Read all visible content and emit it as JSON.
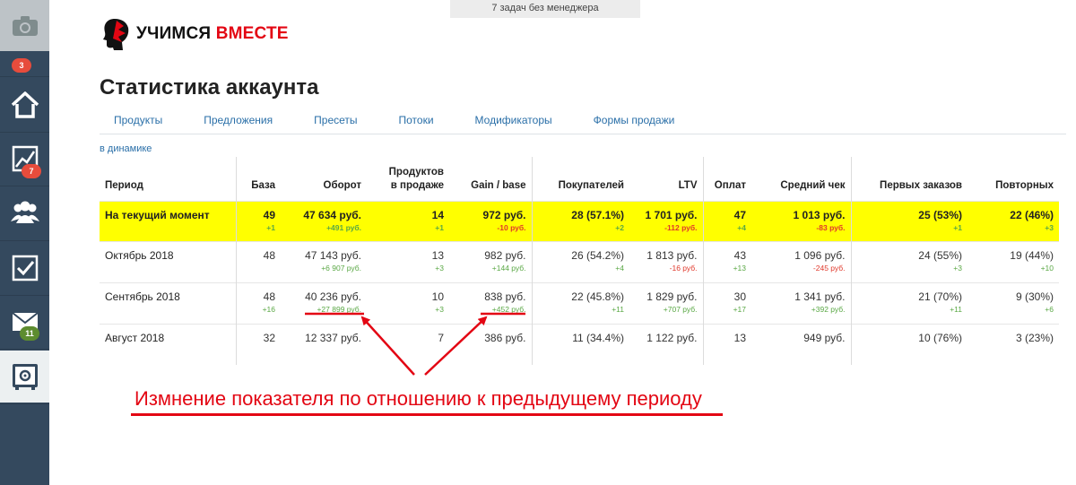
{
  "topbar": {
    "text": "7 задач без менеджера"
  },
  "sidebar": {
    "badges": {
      "notifications": "3",
      "stats": "7",
      "mail": "11"
    }
  },
  "logo": {
    "part1": "УЧИМСЯ",
    "part2": "ВМЕСТЕ"
  },
  "page": {
    "title": "Статистика аккаунта"
  },
  "tabs": [
    "Продукты",
    "Предложения",
    "Пресеты",
    "Потоки",
    "Модификаторы",
    "Формы продажи"
  ],
  "dynamics_link": "в динамике",
  "table": {
    "headers": {
      "period": "Период",
      "base": "База",
      "turnover": "Оборот",
      "products_line1": "Продуктов",
      "products_line2": "в продаже",
      "gain": "Gain / base",
      "buyers": "Покупателей",
      "ltv": "LTV",
      "payments": "Оплат",
      "avg_check": "Средний чек",
      "first_orders": "Первых заказов",
      "repeat": "Повторных"
    },
    "rows": [
      {
        "period": "На текущий момент",
        "base": "49",
        "base_d": "+1",
        "turnover": "47 634 руб.",
        "turnover_d": "+491 руб.",
        "products": "14",
        "products_d": "+1",
        "gain": "972 руб.",
        "gain_d": "-10 руб.",
        "buyers": "28 (57.1%)",
        "buyers_d": "+2",
        "ltv": "1 701 руб.",
        "ltv_d": "-112 руб.",
        "payments": "47",
        "payments_d": "+4",
        "avg_check": "1 013 руб.",
        "avg_check_d": "-83 руб.",
        "first_orders": "25 (53%)",
        "first_orders_d": "+1",
        "repeat": "22 (46%)",
        "repeat_d": "+3"
      },
      {
        "period": "Октябрь 2018",
        "base": "48",
        "base_d": "",
        "turnover": "47 143 руб.",
        "turnover_d": "+6 907 руб.",
        "products": "13",
        "products_d": "+3",
        "gain": "982 руб.",
        "gain_d": "+144 руб.",
        "buyers": "26 (54.2%)",
        "buyers_d": "+4",
        "ltv": "1 813 руб.",
        "ltv_d": "-16 руб.",
        "payments": "43",
        "payments_d": "+13",
        "avg_check": "1 096 руб.",
        "avg_check_d": "-245 руб.",
        "first_orders": "24 (55%)",
        "first_orders_d": "+3",
        "repeat": "19 (44%)",
        "repeat_d": "+10"
      },
      {
        "period": "Сентябрь 2018",
        "base": "48",
        "base_d": "+16",
        "turnover": "40 236 руб.",
        "turnover_d": "+27 899 руб.",
        "products": "10",
        "products_d": "+3",
        "gain": "838 руб.",
        "gain_d": "+452 руб.",
        "buyers": "22 (45.8%)",
        "buyers_d": "+11",
        "ltv": "1 829 руб.",
        "ltv_d": "+707 руб.",
        "payments": "30",
        "payments_d": "+17",
        "avg_check": "1 341 руб.",
        "avg_check_d": "+392 руб.",
        "first_orders": "21 (70%)",
        "first_orders_d": "+11",
        "repeat": "9 (30%)",
        "repeat_d": "+6"
      },
      {
        "period": "Август 2018",
        "base": "32",
        "base_d": "",
        "turnover": "12 337 руб.",
        "turnover_d": "",
        "products": "7",
        "products_d": "",
        "gain": "386 руб.",
        "gain_d": "",
        "buyers": "11 (34.4%)",
        "buyers_d": "",
        "ltv": "1 122 руб.",
        "ltv_d": "",
        "payments": "13",
        "payments_d": "",
        "avg_check": "949 руб.",
        "avg_check_d": "",
        "first_orders": "10 (76%)",
        "first_orders_d": "",
        "repeat": "3 (23%)",
        "repeat_d": ""
      }
    ]
  },
  "annotation": {
    "text": "Измнение показателя по отношению к предыдущему периоду",
    "color": "#e30613"
  },
  "colors": {
    "sidebar": "#34495e",
    "highlight": "#ffff00",
    "link": "#2a6fa8",
    "positive": "#5aa845",
    "negative": "#e0382b"
  }
}
